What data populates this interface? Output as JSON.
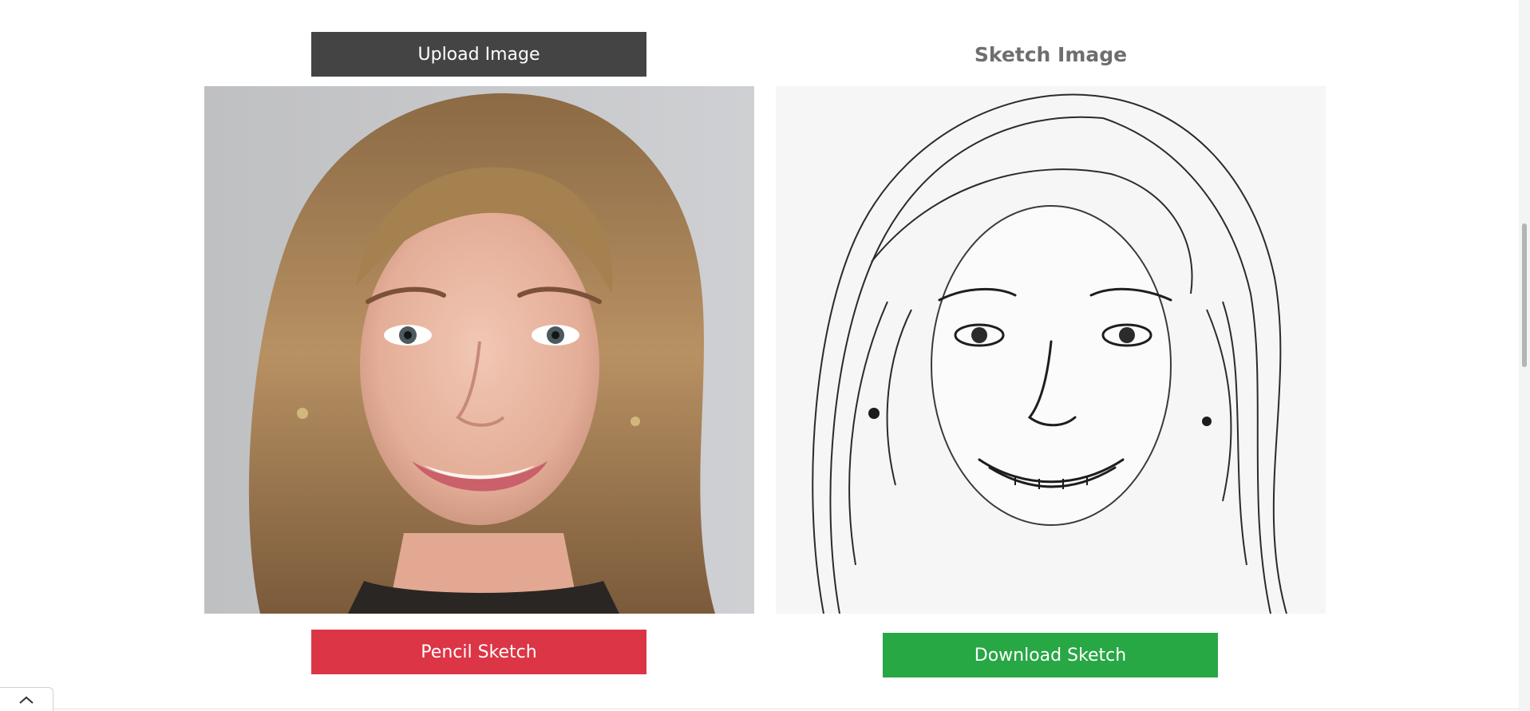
{
  "upload": {
    "label": "Upload Image"
  },
  "sketch": {
    "title": "Sketch Image"
  },
  "actions": {
    "pencil_label": "Pencil Sketch",
    "download_label": "Download Sketch"
  },
  "colors": {
    "upload_bg": "#444444",
    "pencil_bg": "#dc3545",
    "download_bg": "#28a745",
    "title_color": "#6e6e6e"
  },
  "icons": {
    "back_to_top": "chevron-up-icon"
  }
}
